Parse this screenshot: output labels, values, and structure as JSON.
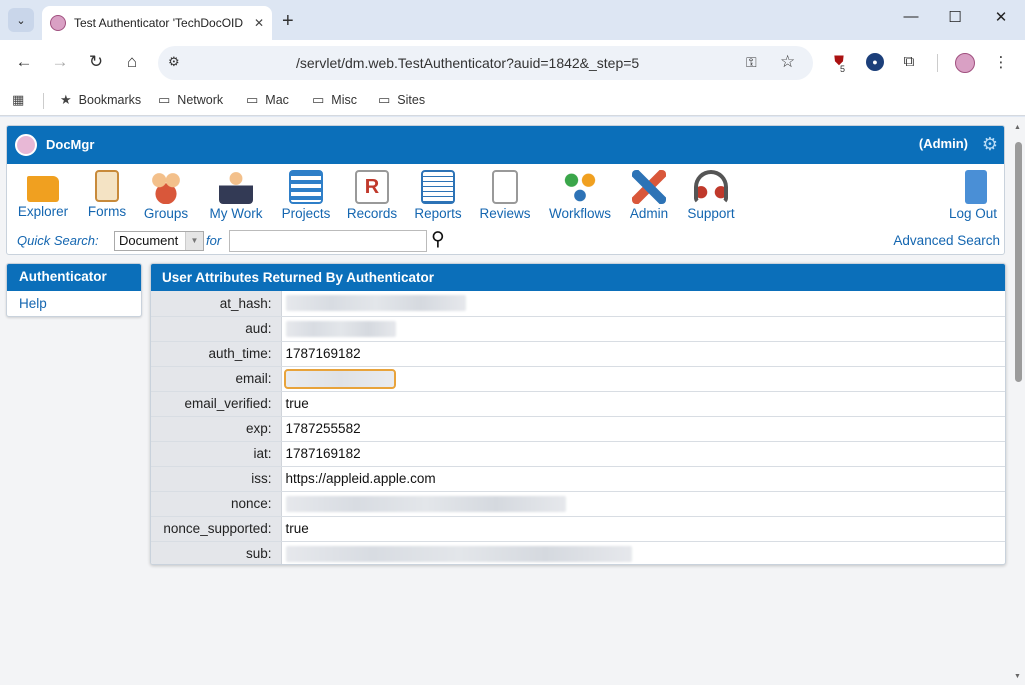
{
  "browser": {
    "tab_title": "Test Authenticator 'TechDocOID",
    "url": "/servlet/dm.web.TestAuthenticator?auid=1842&_step=5",
    "extension_badge": "5",
    "bookmarks": [
      "Bookmarks",
      "Network",
      "Mac",
      "Misc",
      "Sites"
    ]
  },
  "app": {
    "name": "DocMgr",
    "user_role": "(Admin)",
    "nav": [
      {
        "label": "Explorer",
        "icon": "folder-icon",
        "color": "#f0a020"
      },
      {
        "label": "Forms",
        "icon": "clipboard-icon",
        "color": "#c88a3a"
      },
      {
        "label": "Groups",
        "icon": "people-icon",
        "color": "#d9573a"
      },
      {
        "label": "My Work",
        "icon": "person-icon",
        "color": "#333a55"
      },
      {
        "label": "Projects",
        "icon": "gantt-icon",
        "color": "#2f7fc8"
      },
      {
        "label": "Records",
        "icon": "records-icon",
        "color": "#c0392b"
      },
      {
        "label": "Reports",
        "icon": "report-icon",
        "color": "#2d73b6"
      },
      {
        "label": "Reviews",
        "icon": "document-review-icon",
        "color": "#c77b27"
      },
      {
        "label": "Workflows",
        "icon": "workflow-icon",
        "color": "#3aa64a"
      },
      {
        "label": "Admin",
        "icon": "tools-icon",
        "color": "#2d73b6"
      },
      {
        "label": "Support",
        "icon": "headset-icon",
        "color": "#c0392b"
      }
    ],
    "logout_label": "Log Out",
    "quick_search": {
      "label": "Quick Search:",
      "scope": "Document",
      "for_label": "for",
      "query": "",
      "advanced_label": "Advanced Search"
    }
  },
  "sidebar": {
    "title": "Authenticator",
    "items": [
      "Help"
    ]
  },
  "main": {
    "title": "User Attributes Returned By Authenticator",
    "rows": [
      {
        "key": "at_hash:",
        "value": "",
        "redacted": true
      },
      {
        "key": "aud:",
        "value": "",
        "redacted": true
      },
      {
        "key": "auth_time:",
        "value": "1787169182",
        "redacted": false
      },
      {
        "key": "email:",
        "value": "",
        "redacted": true
      },
      {
        "key": "email_verified:",
        "value": "true",
        "redacted": false
      },
      {
        "key": "exp:",
        "value": "1787255582",
        "redacted": false
      },
      {
        "key": "iat:",
        "value": "1787169182",
        "redacted": false
      },
      {
        "key": "iss:",
        "value": "https://appleid.apple.com",
        "redacted": false
      },
      {
        "key": "nonce:",
        "value": "",
        "redacted": true
      },
      {
        "key": "nonce_supported:",
        "value": "true",
        "redacted": false
      },
      {
        "key": "sub:",
        "value": "",
        "redacted": true
      }
    ]
  },
  "colors": {
    "accent": "#0b6fba",
    "link": "#1466b0",
    "focus_outline": "#e8a33b"
  }
}
